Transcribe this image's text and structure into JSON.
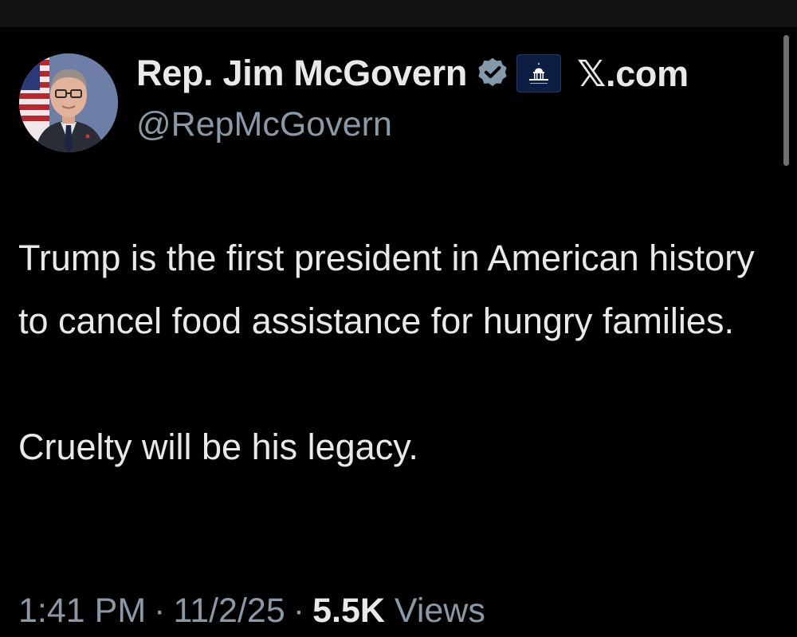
{
  "author": {
    "display_name": "Rep. Jim McGovern",
    "handle": "@RepMcGovern",
    "avatar_icon": "portrait-avatar",
    "verified_icon": "verified-badge-icon",
    "affiliate_icon": "house-democrats-capitol-badge",
    "verified_color": "#829aab"
  },
  "source": {
    "label": "𝕏.com"
  },
  "tweet": {
    "paragraphs": [
      "Trump is the first president in American history to cancel food assistance for hungry families.",
      "Cruelty will be his legacy."
    ]
  },
  "meta": {
    "time": "1:41 PM",
    "separator": "·",
    "date": "11/2/25",
    "views_count": "5.5K",
    "views_label": "Views"
  },
  "colors": {
    "background": "#000000",
    "primary_text": "#e7e9ea",
    "secondary_text": "#8b98a5"
  }
}
